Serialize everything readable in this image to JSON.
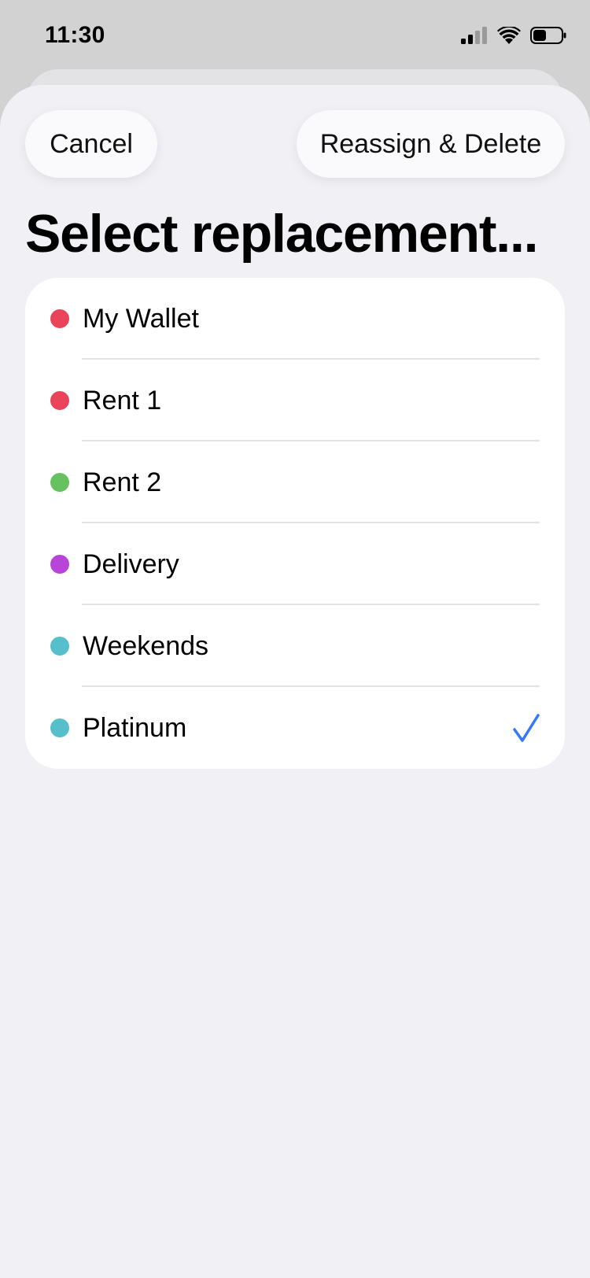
{
  "status_bar": {
    "time": "11:30",
    "icons": [
      "cellular-signal-icon",
      "wifi-icon",
      "battery-icon"
    ]
  },
  "toolbar": {
    "cancel_label": "Cancel",
    "confirm_label": "Reassign & Delete"
  },
  "title": "Select replacement...",
  "accounts": [
    {
      "label": "My Wallet",
      "color": "#e9445a",
      "selected": false
    },
    {
      "label": "Rent 1",
      "color": "#e9445a",
      "selected": false
    },
    {
      "label": "Rent 2",
      "color": "#66c15f",
      "selected": false
    },
    {
      "label": "Delivery",
      "color": "#b844d9",
      "selected": false
    },
    {
      "label": "Weekends",
      "color": "#55bfcc",
      "selected": false
    },
    {
      "label": "Platinum",
      "color": "#55bfcc",
      "selected": true
    }
  ],
  "colors": {
    "accent": "#3478f6",
    "sheet_background": "#f0f0f5",
    "card_background": "#ffffff"
  }
}
